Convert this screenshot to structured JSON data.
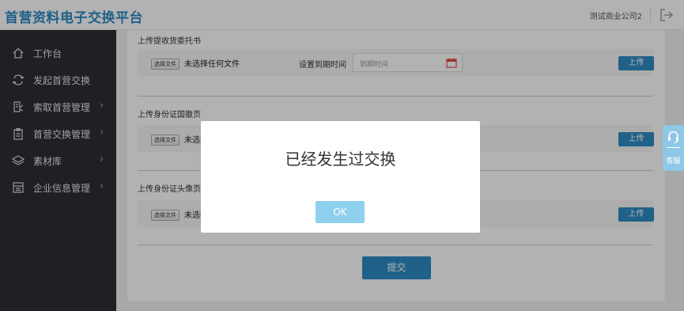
{
  "app": {
    "title": "首营资料电子交换平台",
    "company": "测试商业公司2"
  },
  "sidebar": {
    "items": [
      {
        "label": "工作台",
        "icon": "home-icon",
        "has_arrow": false
      },
      {
        "label": "发起首营交换",
        "icon": "exchange-icon",
        "has_arrow": false
      },
      {
        "label": "索取首营管理",
        "icon": "request-doc-icon",
        "has_arrow": true
      },
      {
        "label": "首营交换管理",
        "icon": "clipboard-icon",
        "has_arrow": true
      },
      {
        "label": "素材库",
        "icon": "layers-icon",
        "has_arrow": true
      },
      {
        "label": "企业信息管理",
        "icon": "company-info-icon",
        "has_arrow": true
      }
    ]
  },
  "sections": [
    {
      "title": "上传提收货委托书",
      "file_button": "选择文件",
      "file_status": "未选择任何文件",
      "expiry_label": "设置到期时间",
      "expiry_placeholder": "到期时间",
      "upload_label": "上传"
    },
    {
      "title": "上传身份证国徽页",
      "file_button": "选择文件",
      "file_status": "未选择任何文件",
      "upload_label": "上传"
    },
    {
      "title": "上传身份证头像页",
      "file_button": "选择文件",
      "file_status": "未选择任何文件",
      "upload_label": "上传"
    }
  ],
  "submit_label": "提交",
  "dialog": {
    "message": "已经发生过交换",
    "ok_label": "OK"
  },
  "support": {
    "label": "客服"
  },
  "colors": {
    "brand": "#2e8bc4",
    "sidebar_bg": "#2c2f35",
    "ok_button": "#8fd0ef",
    "support_bg": "#8fc7e6"
  }
}
